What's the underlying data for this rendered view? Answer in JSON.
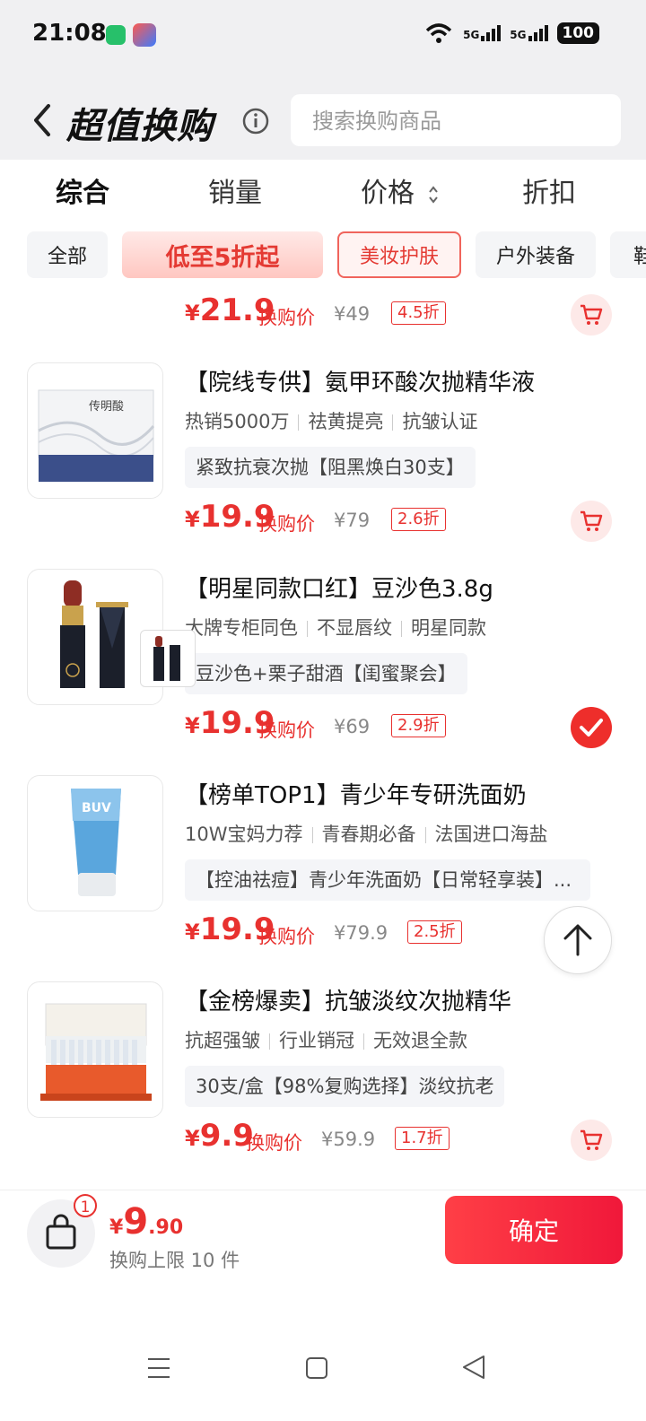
{
  "status_bar": {
    "time": "21:08",
    "signal1": "5G",
    "signal2": "5G",
    "battery": "100"
  },
  "header": {
    "title": "超值换购",
    "search_placeholder": "搜索换购商品"
  },
  "sort_tabs": [
    "综合",
    "销量",
    "价格",
    "折扣"
  ],
  "categories": [
    "全部",
    "低至5折起",
    "美妆护肤",
    "户外装备",
    "鞋"
  ],
  "first_item_price": {
    "price": "21.9",
    "label": "换购价",
    "original": "¥49",
    "discount": "4.5折"
  },
  "products": [
    {
      "title": "【院线专供】氨甲环酸次抛精华液",
      "tags": [
        "热销5000万",
        "祛黄提亮",
        "抗皱认证"
      ],
      "spec": "紧致抗衰次抛【阻黑焕白30支】",
      "price": "19.9",
      "label": "换购价",
      "original": "¥79",
      "discount": "2.6折",
      "thumb_text": "传明酸"
    },
    {
      "title": "【明星同款口红】豆沙色3.8g",
      "tags": [
        "大牌专柜同色",
        "不显唇纹",
        "明星同款"
      ],
      "spec": "豆沙色+栗子甜酒【闺蜜聚会】",
      "price": "19.9",
      "label": "换购价",
      "original": "¥69",
      "discount": "2.9折"
    },
    {
      "title": "【榜单TOP1】青少年专研洗面奶",
      "tags": [
        "10W宝妈力荐",
        "青春期必备",
        "法国进口海盐"
      ],
      "spec": "【控油祛痘】青少年洗面奶【日常轻享装】...",
      "price": "19.9",
      "label": "换购价",
      "original": "¥79.9",
      "discount": "2.5折",
      "thumb_text": "BUV"
    },
    {
      "title": "【金榜爆卖】抗皱淡纹次抛精华",
      "tags": [
        "抗超强皱",
        "行业销冠",
        "无效退全款"
      ],
      "spec": "30支/盒【98%复购选择】淡纹抗老",
      "price": "9.9",
      "label": "换购价",
      "original": "¥59.9",
      "discount": "1.7折"
    }
  ],
  "bottom": {
    "badge": "1",
    "yen": "¥",
    "total_int": "9",
    "total_dec": ".90",
    "limit_text": "换购上限 10 件",
    "confirm": "确定"
  }
}
